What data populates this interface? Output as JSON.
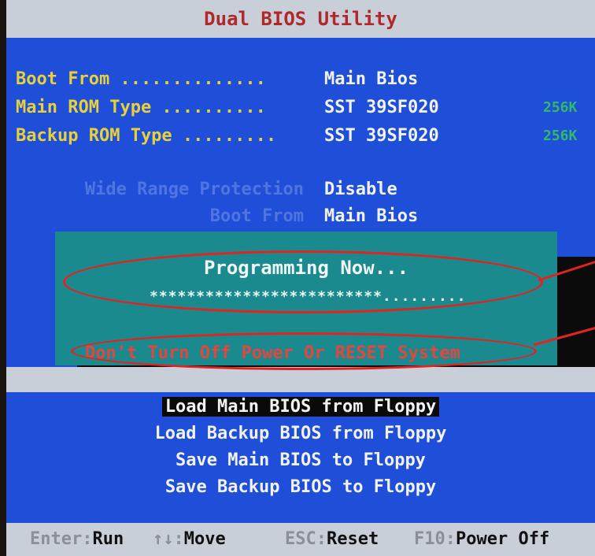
{
  "title": "Dual BIOS Utility",
  "info": {
    "boot_from": {
      "label": "Boot From ..............",
      "value": "Main Bios"
    },
    "main_rom": {
      "label": "Main ROM Type ..........",
      "value": "SST 39SF020",
      "size": "256K"
    },
    "backup_rom": {
      "label": "Backup ROM Type .........",
      "value": "SST 39SF020",
      "size": "256K"
    }
  },
  "settings": {
    "wide_range": {
      "label": "Wide Range Protection",
      "value": "Disable"
    },
    "boot_from": {
      "label": "Boot From",
      "value": "Main Bios"
    }
  },
  "dialog": {
    "status": "Programming Now...",
    "progress_text": "*************************.........",
    "warning": "Don't Turn Off Power Or RESET System"
  },
  "menu": [
    {
      "label": "Load Main BIOS from Floppy"
    },
    {
      "label": "Load Backup BIOS from Floppy"
    },
    {
      "label": "Save Main BIOS to Floppy"
    },
    {
      "label": "Save Backup BIOS to Floppy"
    }
  ],
  "footer": {
    "enter_key": "Enter:",
    "enter_action": "Run",
    "arrows_key": "↑↓:",
    "arrows_action": "Move",
    "esc_key": "ESC:",
    "esc_action": "Reset",
    "f10_key": "F10:",
    "f10_action": "Power Off"
  },
  "colors": {
    "background": "#1f4fd8",
    "dialog": "#1b8a8e",
    "annotation": "#e0241f",
    "warning": "#e2463f",
    "label": "#e7d13a",
    "size": "#32b86a"
  }
}
